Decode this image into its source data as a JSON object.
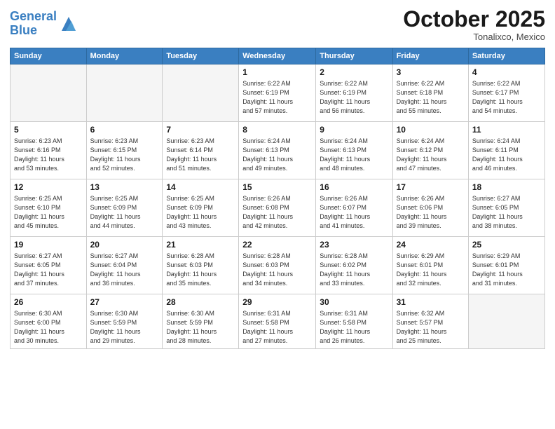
{
  "logo": {
    "line1": "General",
    "line2": "Blue"
  },
  "header": {
    "month": "October 2025",
    "location": "Tonalixco, Mexico"
  },
  "days_of_week": [
    "Sunday",
    "Monday",
    "Tuesday",
    "Wednesday",
    "Thursday",
    "Friday",
    "Saturday"
  ],
  "weeks": [
    [
      {
        "num": "",
        "info": ""
      },
      {
        "num": "",
        "info": ""
      },
      {
        "num": "",
        "info": ""
      },
      {
        "num": "1",
        "info": "Sunrise: 6:22 AM\nSunset: 6:19 PM\nDaylight: 11 hours\nand 57 minutes."
      },
      {
        "num": "2",
        "info": "Sunrise: 6:22 AM\nSunset: 6:19 PM\nDaylight: 11 hours\nand 56 minutes."
      },
      {
        "num": "3",
        "info": "Sunrise: 6:22 AM\nSunset: 6:18 PM\nDaylight: 11 hours\nand 55 minutes."
      },
      {
        "num": "4",
        "info": "Sunrise: 6:22 AM\nSunset: 6:17 PM\nDaylight: 11 hours\nand 54 minutes."
      }
    ],
    [
      {
        "num": "5",
        "info": "Sunrise: 6:23 AM\nSunset: 6:16 PM\nDaylight: 11 hours\nand 53 minutes."
      },
      {
        "num": "6",
        "info": "Sunrise: 6:23 AM\nSunset: 6:15 PM\nDaylight: 11 hours\nand 52 minutes."
      },
      {
        "num": "7",
        "info": "Sunrise: 6:23 AM\nSunset: 6:14 PM\nDaylight: 11 hours\nand 51 minutes."
      },
      {
        "num": "8",
        "info": "Sunrise: 6:24 AM\nSunset: 6:13 PM\nDaylight: 11 hours\nand 49 minutes."
      },
      {
        "num": "9",
        "info": "Sunrise: 6:24 AM\nSunset: 6:13 PM\nDaylight: 11 hours\nand 48 minutes."
      },
      {
        "num": "10",
        "info": "Sunrise: 6:24 AM\nSunset: 6:12 PM\nDaylight: 11 hours\nand 47 minutes."
      },
      {
        "num": "11",
        "info": "Sunrise: 6:24 AM\nSunset: 6:11 PM\nDaylight: 11 hours\nand 46 minutes."
      }
    ],
    [
      {
        "num": "12",
        "info": "Sunrise: 6:25 AM\nSunset: 6:10 PM\nDaylight: 11 hours\nand 45 minutes."
      },
      {
        "num": "13",
        "info": "Sunrise: 6:25 AM\nSunset: 6:09 PM\nDaylight: 11 hours\nand 44 minutes."
      },
      {
        "num": "14",
        "info": "Sunrise: 6:25 AM\nSunset: 6:09 PM\nDaylight: 11 hours\nand 43 minutes."
      },
      {
        "num": "15",
        "info": "Sunrise: 6:26 AM\nSunset: 6:08 PM\nDaylight: 11 hours\nand 42 minutes."
      },
      {
        "num": "16",
        "info": "Sunrise: 6:26 AM\nSunset: 6:07 PM\nDaylight: 11 hours\nand 41 minutes."
      },
      {
        "num": "17",
        "info": "Sunrise: 6:26 AM\nSunset: 6:06 PM\nDaylight: 11 hours\nand 39 minutes."
      },
      {
        "num": "18",
        "info": "Sunrise: 6:27 AM\nSunset: 6:05 PM\nDaylight: 11 hours\nand 38 minutes."
      }
    ],
    [
      {
        "num": "19",
        "info": "Sunrise: 6:27 AM\nSunset: 6:05 PM\nDaylight: 11 hours\nand 37 minutes."
      },
      {
        "num": "20",
        "info": "Sunrise: 6:27 AM\nSunset: 6:04 PM\nDaylight: 11 hours\nand 36 minutes."
      },
      {
        "num": "21",
        "info": "Sunrise: 6:28 AM\nSunset: 6:03 PM\nDaylight: 11 hours\nand 35 minutes."
      },
      {
        "num": "22",
        "info": "Sunrise: 6:28 AM\nSunset: 6:03 PM\nDaylight: 11 hours\nand 34 minutes."
      },
      {
        "num": "23",
        "info": "Sunrise: 6:28 AM\nSunset: 6:02 PM\nDaylight: 11 hours\nand 33 minutes."
      },
      {
        "num": "24",
        "info": "Sunrise: 6:29 AM\nSunset: 6:01 PM\nDaylight: 11 hours\nand 32 minutes."
      },
      {
        "num": "25",
        "info": "Sunrise: 6:29 AM\nSunset: 6:01 PM\nDaylight: 11 hours\nand 31 minutes."
      }
    ],
    [
      {
        "num": "26",
        "info": "Sunrise: 6:30 AM\nSunset: 6:00 PM\nDaylight: 11 hours\nand 30 minutes."
      },
      {
        "num": "27",
        "info": "Sunrise: 6:30 AM\nSunset: 5:59 PM\nDaylight: 11 hours\nand 29 minutes."
      },
      {
        "num": "28",
        "info": "Sunrise: 6:30 AM\nSunset: 5:59 PM\nDaylight: 11 hours\nand 28 minutes."
      },
      {
        "num": "29",
        "info": "Sunrise: 6:31 AM\nSunset: 5:58 PM\nDaylight: 11 hours\nand 27 minutes."
      },
      {
        "num": "30",
        "info": "Sunrise: 6:31 AM\nSunset: 5:58 PM\nDaylight: 11 hours\nand 26 minutes."
      },
      {
        "num": "31",
        "info": "Sunrise: 6:32 AM\nSunset: 5:57 PM\nDaylight: 11 hours\nand 25 minutes."
      },
      {
        "num": "",
        "info": ""
      }
    ]
  ]
}
